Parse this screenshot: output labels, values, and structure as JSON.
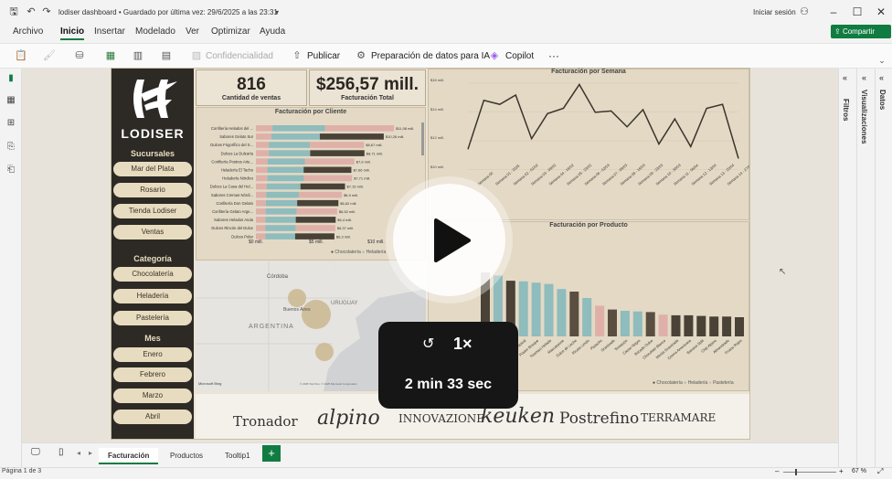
{
  "window": {
    "title": "lodiser dashboard • Guardado por última vez: 29/6/2025 a las 23:31",
    "signin": "Iniciar sesión"
  },
  "menu": [
    "Archivo",
    "Inicio",
    "Insertar",
    "Modelado",
    "Ver",
    "Optimizar",
    "Ayuda"
  ],
  "share": "Compartir",
  "ribbon": {
    "confidencialidad": "Confidencialidad",
    "publicar": "Publicar",
    "preparacion": "Preparación de datos para IA",
    "copilot": "Copilot",
    "more": "···"
  },
  "brand": "LODISER",
  "sections": {
    "sucursales": "Sucursales",
    "categoria": "Categoría",
    "mes": "Mes"
  },
  "sucursales": [
    "Mar del Plata",
    "Rosario",
    "Tienda Lodiser",
    "Ventas"
  ],
  "categorias": [
    "Chocolatería",
    "Heladería",
    "Pastelería"
  ],
  "meses": [
    "Enero",
    "Febrero",
    "Marzo",
    "Abril"
  ],
  "kpi": {
    "ventas_value": "816",
    "ventas_label": "Cantidad de ventas",
    "fact_value": "$256,57 mill.",
    "fact_label": "Facturación Total"
  },
  "cliente_chart": {
    "title": "Facturación por Cliente",
    "axis": [
      "$0 mill.",
      "$5 mill.",
      "$10 mill."
    ],
    "legend": [
      "Chocolatería",
      "Heladería"
    ]
  },
  "semana_chart": {
    "title": "Facturación por Semana",
    "yticks": [
      "$16 mill.",
      "$14 mill.",
      "$12 mill.",
      "$10 mill."
    ]
  },
  "producto_chart": {
    "title": "Facturación por Producto",
    "legend": [
      "Chocolatería",
      "Heladería",
      "Pastelería"
    ]
  },
  "map": {
    "labels": [
      "Córdoba",
      "ARGENTINA",
      "URUGUAY",
      "Buenos Aires"
    ],
    "credit": "© 2025 TomTom, © 2025 Microsoft Corporation",
    "brand": "Microsoft Bing"
  },
  "logos": [
    "Tronador",
    "alpino",
    "INNOVAZIONE",
    "keuken",
    "Postrefino",
    "TERRAMARE"
  ],
  "filters": {
    "filtros": "Filtros",
    "visualizaciones": "Visualizaciones",
    "datos": "Datos"
  },
  "tabs": [
    "Facturación",
    "Productos",
    "Tooltip1"
  ],
  "addtab": "+",
  "status": {
    "page": "Página 1 de 3",
    "zoom": "67 %"
  },
  "overlay": {
    "speed": "1×",
    "duration": "2 min 33 sec"
  },
  "chart_data": [
    {
      "type": "bar",
      "title": "Facturación por Cliente",
      "categories": [
        "Confitería Helados del ...",
        "Sabores Gelato Sur",
        "Dulces Frigorífico del S...",
        "Dulces La Dulzaría",
        "Confitería Postres Arte...",
        "Heladería El Tacho",
        "Heladería Nórdico",
        "Dulces La Casa del Hel...",
        "Sabores Cremas Nórdi...",
        "Confitería Don Gelato",
        "Confitería Gelato Arge...",
        "Sabores Helados Anda",
        "Dulces Rincón del Dulce",
        "Dulces Polar"
      ],
      "labels": [
        "$11,08 mill.",
        "$10,26 mill.",
        "$8,67 mill.",
        "$8,71 mill.",
        "$7,9 mill.",
        "$7,66 mill.",
        "$7,71 mill.",
        "$7,15 mill.",
        "$6,9 mill.",
        "$6,62 mill.",
        "$6,52 mill.",
        "$6,4 mill.",
        "$6,37 mill.",
        "$6,3 mill."
      ],
      "values": [
        11.08,
        10.26,
        8.67,
        8.71,
        7.9,
        7.66,
        7.71,
        7.15,
        6.9,
        6.62,
        6.52,
        6.4,
        6.37,
        6.3
      ],
      "xlim": [
        0,
        11
      ]
    },
    {
      "type": "line",
      "title": "Facturación por Semana",
      "x": [
        "Semana 00",
        "Semana 01 - 2025",
        "Semana 02 - 01/02",
        "Semana 03 - 09/02",
        "Semana 04 - 16/02",
        "Semana 05 - 23/02",
        "Semana 06 - 02/03",
        "Semana 07 - 09/03",
        "Semana 08 - 16/03",
        "Semana 09 - 23/03",
        "Semana 10 - 30/03",
        "Semana 11 - 06/04",
        "Semana 12 - 13/04",
        "Semana 13 - 20/04",
        "Semana 14 - 27/04"
      ],
      "values": [
        11.5,
        15.2,
        14.9,
        15.6,
        12.3,
        14.2,
        14.6,
        16.4,
        14.3,
        14.4,
        13.2,
        14.5,
        11.9,
        13.8,
        11.7,
        14.6,
        14.9,
        10.8
      ],
      "ylim": [
        10,
        16.5
      ]
    },
    {
      "type": "bar",
      "title": "Facturación por Producto",
      "values": [
        100,
        95,
        87,
        86,
        84,
        82,
        74,
        70,
        60,
        48,
        42,
        40,
        39,
        38,
        34,
        33,
        33,
        32,
        31,
        31,
        30
      ],
      "series_colors": [
        "#4a4236",
        "#8fbcbc",
        "#4a4236",
        "#8fbcbc",
        "#8fbcbc",
        "#8fbcbc",
        "#8fbcbc",
        "#5a4e40",
        "#8fbcbc",
        "#dfb0a8",
        "#5a4e40",
        "#8fbcbc",
        "#8fbcbc",
        "#5a4e40",
        "#dfb0a8",
        "#4a4236",
        "#4a4236",
        "#4a4236",
        "#4a4236",
        "#4a4236",
        "#4a4236"
      ]
    }
  ]
}
